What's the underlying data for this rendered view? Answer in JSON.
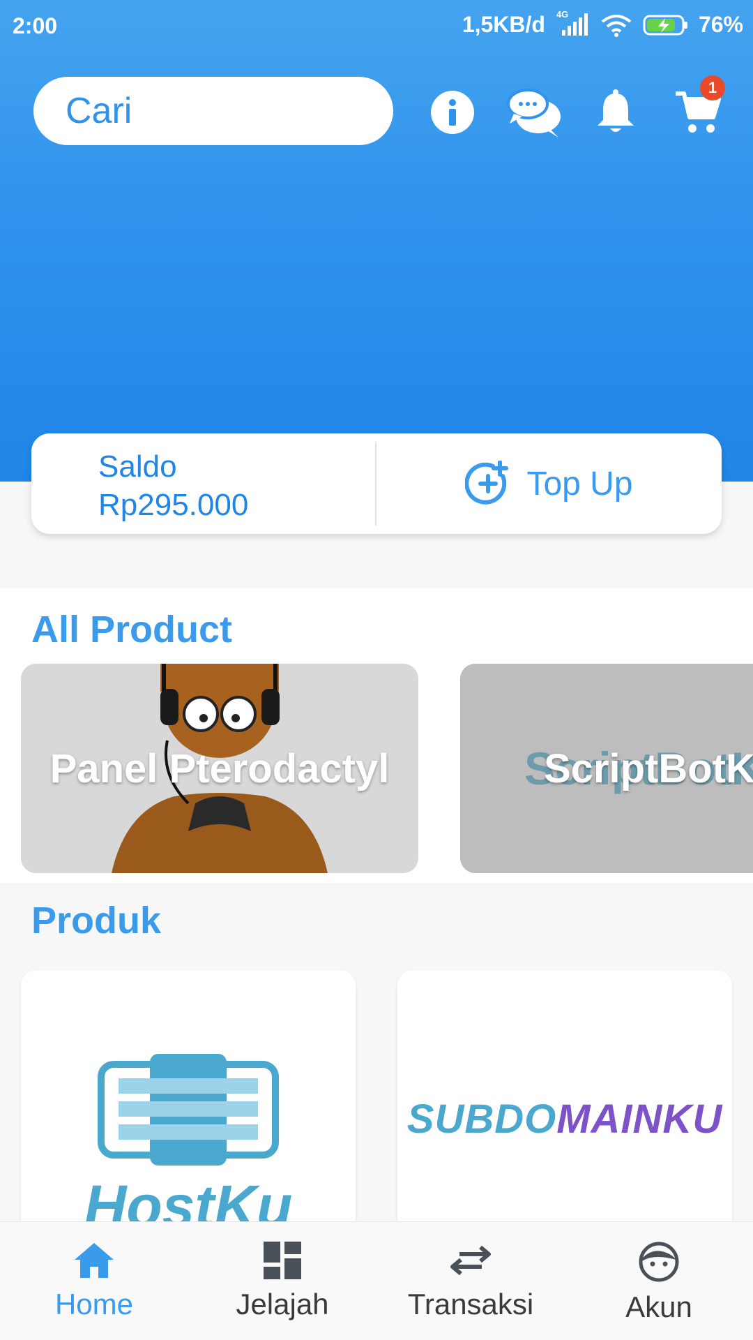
{
  "status_bar": {
    "time": "2:00",
    "net_speed": "1,5KB/d",
    "network_type": "4G",
    "battery": "76%"
  },
  "header": {
    "search_placeholder": "Cari",
    "cart_count": "1",
    "icons": [
      "info-icon",
      "chat-icon",
      "bell-icon",
      "cart-icon"
    ]
  },
  "balance": {
    "label": "Saldo",
    "amount": "Rp295.000",
    "topup_label": "Top Up"
  },
  "all_product": {
    "title": "All Product",
    "items": [
      {
        "label": "Panel Pterodactyl"
      },
      {
        "label": "ScriptBotK",
        "logo_text": "ScriptBotK"
      }
    ]
  },
  "produk": {
    "title": "Produk",
    "items": [
      {
        "logo_text": "HostKu"
      },
      {
        "logo_text_a": "SUBDO",
        "logo_text_b": "MAINKU"
      }
    ]
  },
  "bottom_nav": {
    "items": [
      {
        "label": "Home",
        "icon": "home-icon",
        "active": true
      },
      {
        "label": "Jelajah",
        "icon": "dashboard-icon",
        "active": false
      },
      {
        "label": "Transaksi",
        "icon": "swap-icon",
        "active": false
      },
      {
        "label": "Akun",
        "icon": "face-icon",
        "active": false
      }
    ]
  },
  "colors": {
    "primary": "#2f93ec",
    "accent_text": "#3a9bec",
    "badge": "#e84a2a",
    "hostku_teal": "#4aa8cf",
    "subdomain_purple": "#7d52c9"
  }
}
